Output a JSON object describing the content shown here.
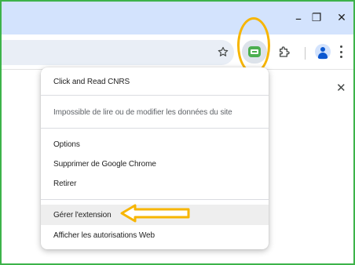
{
  "window": {
    "minimize_glyph": "–",
    "restore_glyph": "❐",
    "close_glyph": "✕"
  },
  "toolbar": {
    "bookmark_icon": "star-outline",
    "extension_icon": "click-and-read-cnrs-logo",
    "extensions_icon": "puzzle-piece",
    "profile_icon": "person-avatar",
    "menu_icon": "three-dots-vertical"
  },
  "page": {
    "close_glyph": "✕"
  },
  "context_menu": {
    "title": "Click and Read CNRS",
    "site_access": "Impossible de lire ou de modifier les données du site",
    "options": "Options",
    "remove_chrome": "Supprimer de Google Chrome",
    "unpin": "Retirer",
    "manage": "Gérer l'extension",
    "web_permissions": "Afficher les autorisations Web"
  },
  "colors": {
    "annotation": "#f7b500",
    "frame_border": "#3db34a",
    "titlebar": "#d3e3fd",
    "omnibox": "#e9eef6"
  }
}
